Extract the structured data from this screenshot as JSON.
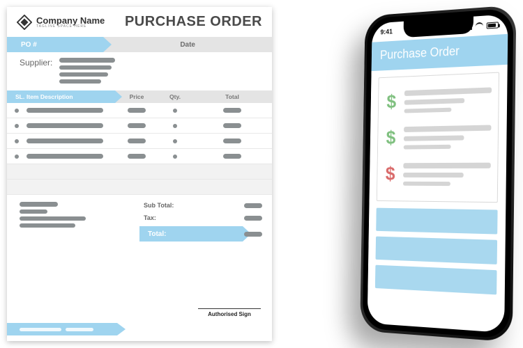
{
  "doc": {
    "company_name": "Company Name",
    "tagline": "TAGLINE SPACE HERE",
    "title": "PURCHASE ORDER",
    "band": {
      "po_label": "PO #",
      "date_label": "Date"
    },
    "supplier_label": "Supplier:",
    "table": {
      "headers": {
        "sl": "SL.",
        "desc": "Item Description",
        "price": "Price",
        "qty": "Qty.",
        "total": "Total"
      }
    },
    "summary": {
      "subtotal_label": "Sub Total:",
      "tax_label": "Tax:",
      "total_label": "Total:"
    },
    "sign_label": "Authorised Sign"
  },
  "phone": {
    "status_time": "9:41",
    "app_title": "Purchase Order"
  }
}
